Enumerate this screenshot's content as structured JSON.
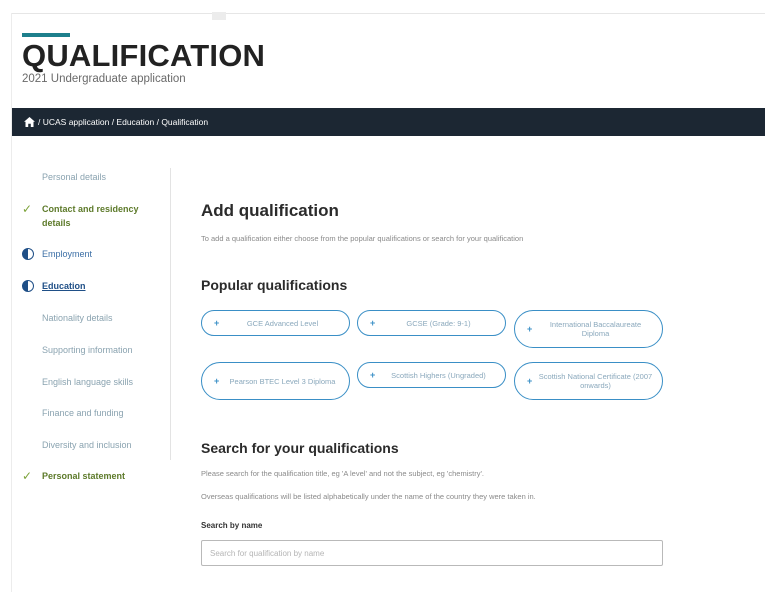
{
  "header": {
    "title": "QUALIFICATION",
    "subtitle": "2021 Undergraduate application",
    "accent_color": "#1d7f8c"
  },
  "breadcrumb": {
    "home_icon": "home-icon",
    "text": " / UCAS application / Education / Qualification"
  },
  "sidebar": {
    "items": [
      {
        "label": "Personal details",
        "status": "none"
      },
      {
        "label": "Contact and residency details",
        "status": "complete"
      },
      {
        "label": "Employment",
        "status": "in-progress"
      },
      {
        "label": "Education",
        "status": "in-progress-current"
      },
      {
        "label": "Nationality details",
        "status": "none"
      },
      {
        "label": "Supporting information",
        "status": "none"
      },
      {
        "label": "English language skills",
        "status": "none"
      },
      {
        "label": "Finance and funding",
        "status": "none"
      },
      {
        "label": "Diversity and inclusion",
        "status": "none"
      },
      {
        "label": "Personal statement",
        "status": "complete"
      }
    ]
  },
  "main": {
    "add_heading": "Add qualification",
    "add_text": "To add a qualification either choose from the popular qualifications or search for your qualification",
    "popular_heading": "Popular qualifications",
    "chips": [
      {
        "label": "GCE Advanced Level"
      },
      {
        "label": "GCSE (Grade: 9-1)"
      },
      {
        "label": "International Baccalaureate Diploma"
      },
      {
        "label": "Pearson BTEC Level 3 Diploma"
      },
      {
        "label": "Scottish Highers (Ungraded)"
      },
      {
        "label": "Scottish National Certificate (2007 onwards)"
      }
    ],
    "chip_plus": "+",
    "search_heading": "Search for your qualifications",
    "search_text_1": "Please search for the qualification title, eg 'A level' and not the subject, eg 'chemistry'.",
    "search_text_2": "Overseas qualifications will be listed alphabetically under the name of the country they were taken in.",
    "search_label": "Search by name",
    "search_value": "",
    "search_placeholder": "Search for qualification by name"
  },
  "colors": {
    "nav_bar": "#1c2733",
    "chip_border": "#3a8fc6",
    "complete_check": "#7da33a",
    "current_link": "#1f4f87"
  }
}
